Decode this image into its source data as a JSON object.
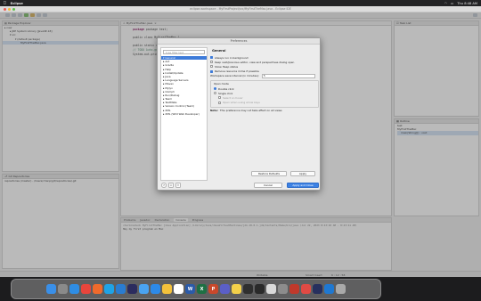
{
  "menubar": {
    "app_name": "Eclipse",
    "menus": [
      "File",
      "Edit",
      "Source",
      "Refactor",
      "Navigate",
      "Search",
      "Project",
      "Run",
      "Window",
      "Help"
    ],
    "clock": "Thu 8:48 AM"
  },
  "window": {
    "title": "eclipse-workspace - MyFirstProject/src/MyFirstTheMac.java - Eclipse IDE"
  },
  "package_explorer": {
    "title": "Package Explorer",
    "items": [
      {
        "label": "new"
      },
      {
        "label": "JRE System Library [JavaSE-18]"
      },
      {
        "label": "src"
      },
      {
        "label": "(default package)"
      },
      {
        "label": "MyFirstTheMac.java"
      }
    ]
  },
  "editor": {
    "tab": "MyFirstTheMac.java",
    "lines": [
      "package  test;",
      "",
      "public class MyFirstTheMac {",
      "",
      "    public static void main(String[] args) {",
      "        // TODO Auto-generated method stub",
      "        System.out.println(\"Hey my first program on Mac\");"
    ]
  },
  "task_list": {
    "title": "Task List"
  },
  "outline": {
    "title": "Outline",
    "items": [
      "test",
      "MyFirstTheMac",
      "main(String[]) : void"
    ]
  },
  "git_repos": {
    "title": "Git Repositories",
    "items": [
      "repositories (master) - /Users/chanp/git/repositories/.git"
    ]
  },
  "dialog": {
    "title": "Preferences",
    "filter_placeholder": "type filter text",
    "nav": [
      {
        "label": "General",
        "selected": true
      },
      {
        "label": "Ant"
      },
      {
        "label": "Gradle"
      },
      {
        "label": "Help"
      },
      {
        "label": "Install/Update"
      },
      {
        "label": "Java"
      },
      {
        "label": "Language Servers"
      },
      {
        "label": "Maven"
      },
      {
        "label": "Mylyn"
      },
      {
        "label": "Oomph"
      },
      {
        "label": "Run/Debug"
      },
      {
        "label": "Team"
      },
      {
        "label": "TextMate"
      },
      {
        "label": "Version Control (Team)"
      },
      {
        "label": "XML"
      },
      {
        "label": "XML (Wild Web Developer)"
      }
    ],
    "page_title": "General",
    "opt1": "Always run in background",
    "opt2": "Keep next/previous editor, view and perspectives dialog open",
    "opt3": "Show Heap status",
    "opt4": "Remove resource mime if possible",
    "opt5_label": "Workspace save interval (in minutes):",
    "opt5_value": "5",
    "open_mode": {
      "title": "Open mode",
      "double": "Double click",
      "single": "Single click",
      "select_hover": "Select on hover",
      "open_arrow": "Open when using arrow keys"
    },
    "note_label": "Note:",
    "note_text": "This preference may not take effect on all views",
    "restore_defaults": "Restore Defaults",
    "apply": "Apply",
    "cancel": "Cancel",
    "apply_close": "Apply and Close"
  },
  "console": {
    "tabs": [
      "Problems",
      "Javadoc",
      "Declaration",
      "Console",
      "Progress"
    ],
    "active_tab": "Console",
    "header": "<terminated> MyFirstTheMac [Java Application] /Library/Java/JavaVirtualMachines/jdk-18.0.1.jdk/Contents/Home/bin/java  (Jul 22, 2023 8:43:40 AM - 8:43:41 AM)",
    "output": "Hey my first program on Mac"
  },
  "status": {
    "writable": "Writable",
    "insert": "Smart Insert",
    "position": "6 : 12 : 58"
  },
  "dock": {
    "apps": [
      {
        "name": "finder-icon",
        "color": "#3a8fe8",
        "glyph": ""
      },
      {
        "name": "launchpad-icon",
        "color": "#8a8a8a",
        "glyph": ""
      },
      {
        "name": "safari-icon",
        "color": "#2f8de4",
        "glyph": ""
      },
      {
        "name": "chrome-icon",
        "color": "#e8453c",
        "glyph": ""
      },
      {
        "name": "firefox-icon",
        "color": "#ef6a2c",
        "glyph": ""
      },
      {
        "name": "skype-icon",
        "color": "#1fa3e6",
        "glyph": ""
      },
      {
        "name": "vscode-icon",
        "color": "#2a7cd0",
        "glyph": ""
      },
      {
        "name": "eclipse-icon",
        "color": "#2c2c5e",
        "glyph": ""
      },
      {
        "name": "mail-icon",
        "color": "#4aa3f0",
        "glyph": ""
      },
      {
        "name": "store-icon",
        "color": "#2d8ae8",
        "glyph": ""
      },
      {
        "name": "photos-icon",
        "color": "#f3c13b",
        "glyph": ""
      },
      {
        "name": "calendar-icon",
        "color": "#ffffff",
        "glyph": ""
      },
      {
        "name": "word-icon",
        "color": "#2b5ba9",
        "glyph": "W"
      },
      {
        "name": "excel-icon",
        "color": "#1e7044",
        "glyph": "X"
      },
      {
        "name": "powerpoint-icon",
        "color": "#c9482b",
        "glyph": "P"
      },
      {
        "name": "teams-icon",
        "color": "#5b5fc7",
        "glyph": ""
      },
      {
        "name": "notes-icon",
        "color": "#f2d04a",
        "glyph": ""
      },
      {
        "name": "bear-icon",
        "color": "#2f2f2f",
        "glyph": ""
      },
      {
        "name": "terminal-icon",
        "color": "#2a2a2a",
        "glyph": ""
      },
      {
        "name": "preview-icon",
        "color": "#d9d9d9",
        "glyph": ""
      },
      {
        "name": "settings-icon",
        "color": "#8c8c8c",
        "glyph": ""
      },
      {
        "name": "mariadb-icon",
        "color": "#c0392b",
        "glyph": ""
      },
      {
        "name": "vpn-icon",
        "color": "#e14a44",
        "glyph": ""
      },
      {
        "name": "eclipse-running-icon",
        "color": "#27305e",
        "glyph": ""
      },
      {
        "name": "downloads-icon",
        "color": "#1f78d1",
        "glyph": ""
      },
      {
        "name": "trash-icon",
        "color": "#a9a9a9",
        "glyph": ""
      }
    ]
  }
}
